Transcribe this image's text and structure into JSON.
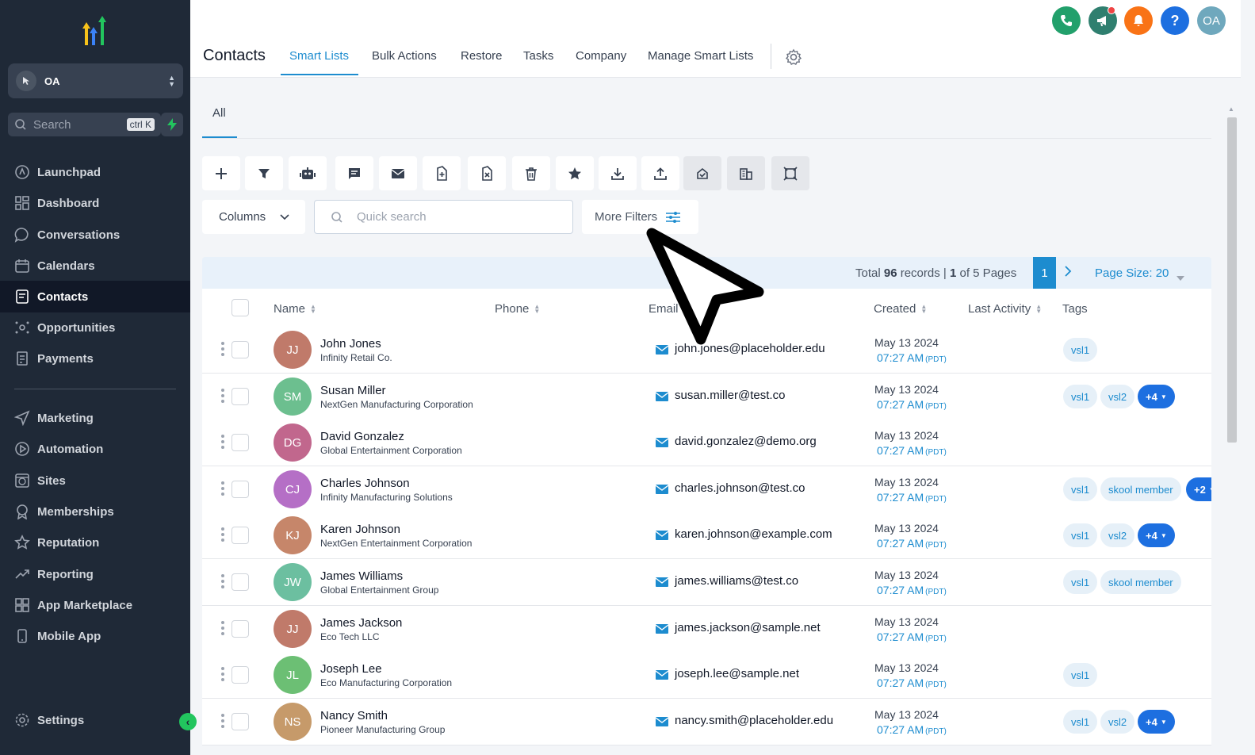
{
  "sidebar": {
    "account_name": "OA",
    "search_placeholder": "Search",
    "search_shortcut": "ctrl K",
    "items": [
      {
        "label": "Launchpad",
        "icon": "launchpad-icon"
      },
      {
        "label": "Dashboard",
        "icon": "dashboard-icon"
      },
      {
        "label": "Conversations",
        "icon": "chat-bubble-icon"
      },
      {
        "label": "Calendars",
        "icon": "calendar-icon"
      },
      {
        "label": "Contacts",
        "icon": "contacts-book-icon",
        "active": true
      },
      {
        "label": "Opportunities",
        "icon": "opportunities-icon"
      },
      {
        "label": "Payments",
        "icon": "payments-icon"
      },
      {
        "label": "Marketing",
        "icon": "send-icon"
      },
      {
        "label": "Automation",
        "icon": "automation-icon"
      },
      {
        "label": "Sites",
        "icon": "globe-icon"
      },
      {
        "label": "Memberships",
        "icon": "award-icon"
      },
      {
        "label": "Reputation",
        "icon": "star-icon"
      },
      {
        "label": "Reporting",
        "icon": "trending-icon"
      },
      {
        "label": "App Marketplace",
        "icon": "grid-icon"
      },
      {
        "label": "Mobile App",
        "icon": "phone-icon"
      }
    ],
    "settings_label": "Settings"
  },
  "header": {
    "title": "Contacts",
    "tabs": [
      "Smart Lists",
      "Bulk Actions",
      "Restore",
      "Tasks",
      "Company",
      "Manage Smart Lists"
    ],
    "active_tab": "Smart Lists",
    "user_initials": "OA",
    "help_label": "?"
  },
  "subtabs": [
    "All"
  ],
  "toolbar": {
    "columns_label": "Columns",
    "search_placeholder": "Quick search",
    "more_filters_label": "More Filters",
    "icons": [
      "add-icon",
      "filter-icon",
      "robot-icon",
      "message-icon",
      "email-icon",
      "add-tag-icon",
      "remove-tag-icon",
      "delete-icon",
      "star-icon",
      "download-icon",
      "upload-icon",
      "merge-icon",
      "company-icon",
      "export-icon"
    ]
  },
  "pagination": {
    "total_label": "Total",
    "total": "96",
    "records_label": "records |",
    "page": "1",
    "of_label": "of 5 Pages",
    "current_page": "1",
    "page_size_label": "Page Size: 20"
  },
  "table": {
    "columns": [
      "Name",
      "Phone",
      "Email",
      "Created",
      "Last Activity",
      "Tags"
    ],
    "rows": [
      {
        "initials": "JJ",
        "name": "John Jones",
        "company": "Infinity Retail Co.",
        "email": "john.jones@placeholder.edu",
        "date": "May 13 2024",
        "time": "07:27 AM",
        "tz": "(PDT)",
        "color": "#c07a6a",
        "tags": [
          "vsl1"
        ],
        "more": ""
      },
      {
        "initials": "SM",
        "name": "Susan Miller",
        "company": "NextGen Manufacturing Corporation",
        "email": "susan.miller@test.co",
        "date": "May 13 2024",
        "time": "07:27 AM",
        "tz": "(PDT)",
        "color": "#6cbf8f",
        "tags": [
          "vsl1",
          "vsl2"
        ],
        "more": "+4"
      },
      {
        "initials": "DG",
        "name": "David Gonzalez",
        "company": "Global Entertainment Corporation",
        "email": "david.gonzalez@demo.org",
        "date": "May 13 2024",
        "time": "07:27 AM",
        "tz": "(PDT)",
        "color": "#c1678d",
        "tags": [],
        "more": ""
      },
      {
        "initials": "CJ",
        "name": "Charles Johnson",
        "company": "Infinity Manufacturing Solutions",
        "email": "charles.johnson@test.co",
        "date": "May 13 2024",
        "time": "07:27 AM",
        "tz": "(PDT)",
        "color": "#b56fc6",
        "tags": [
          "vsl1",
          "skool member"
        ],
        "more": "+2"
      },
      {
        "initials": "KJ",
        "name": "Karen Johnson",
        "company": "NextGen Entertainment Corporation",
        "email": "karen.johnson@example.com",
        "date": "May 13 2024",
        "time": "07:27 AM",
        "tz": "(PDT)",
        "color": "#c6866a",
        "tags": [
          "vsl1",
          "vsl2"
        ],
        "more": "+4"
      },
      {
        "initials": "JW",
        "name": "James Williams",
        "company": "Global Entertainment Group",
        "email": "james.williams@test.co",
        "date": "May 13 2024",
        "time": "07:27 AM",
        "tz": "(PDT)",
        "color": "#6cbfa0",
        "tags": [
          "vsl1",
          "skool member"
        ],
        "more": ""
      },
      {
        "initials": "JJ",
        "name": "James Jackson",
        "company": "Eco Tech LLC",
        "email": "james.jackson@sample.net",
        "date": "May 13 2024",
        "time": "07:27 AM",
        "tz": "(PDT)",
        "color": "#c07a6a",
        "tags": [],
        "more": ""
      },
      {
        "initials": "JL",
        "name": "Joseph Lee",
        "company": "Eco Manufacturing Corporation",
        "email": "joseph.lee@sample.net",
        "date": "May 13 2024",
        "time": "07:27 AM",
        "tz": "(PDT)",
        "color": "#6cbf74",
        "tags": [
          "vsl1"
        ],
        "more": ""
      },
      {
        "initials": "NS",
        "name": "Nancy Smith",
        "company": "Pioneer Manufacturing Group",
        "email": "nancy.smith@placeholder.edu",
        "date": "May 13 2024",
        "time": "07:27 AM",
        "tz": "(PDT)",
        "color": "#c69a6a",
        "tags": [
          "vsl1",
          "vsl2"
        ],
        "more": "+4"
      }
    ]
  },
  "colors": {
    "accent": "#1d8ccf",
    "sidebar": "#1f2937",
    "call": "#22a06b",
    "announce": "#2f7f6f",
    "notify": "#f97316",
    "help": "#1d6fe0",
    "avatar": "#6fa8bd"
  }
}
